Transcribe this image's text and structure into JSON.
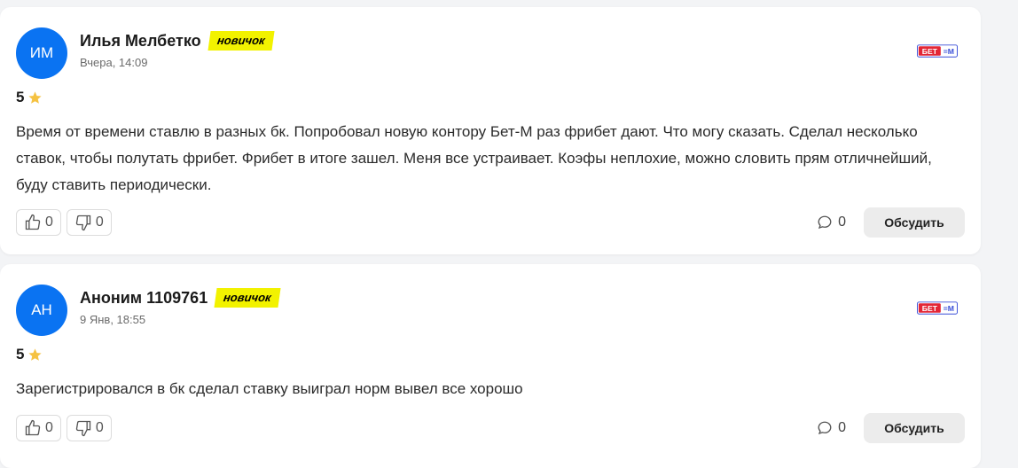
{
  "colors": {
    "avatar_bg": "#0a73f2",
    "badge_bg": "#f2f200",
    "star": "#f5c242",
    "brand_red": "#e32636",
    "brand_blue": "#3a4fd8"
  },
  "reviews": [
    {
      "avatar_initials": "ИМ",
      "author": "Илья Мелбетко",
      "badge": "новичок",
      "date": "Вчера, 14:09",
      "rating": "5",
      "text": "Время от времени ставлю в разных бк. Попробовал новую контору Бет-М раз фрибет дают. Что могу сказать. Сделал несколько ставок, чтобы полутать фрибет. Фрибет в итоге зашел. Меня все устраивает. Коэфы неплохие, можно словить прям отличнейший, буду ставить периодически.",
      "likes": "0",
      "dislikes": "0",
      "comments": "0",
      "discuss_label": "Обсудить",
      "brand_logo": "БЕТ-М"
    },
    {
      "avatar_initials": "АН",
      "author": "Аноним 1109761",
      "badge": "новичок",
      "date": "9 Янв, 18:55",
      "rating": "5",
      "text": "Зарегистрировался в бк сделал ставку выиграл норм вывел все хорошо",
      "likes": "0",
      "dislikes": "0",
      "comments": "0",
      "discuss_label": "Обсудить",
      "brand_logo": "БЕТ-М"
    }
  ]
}
